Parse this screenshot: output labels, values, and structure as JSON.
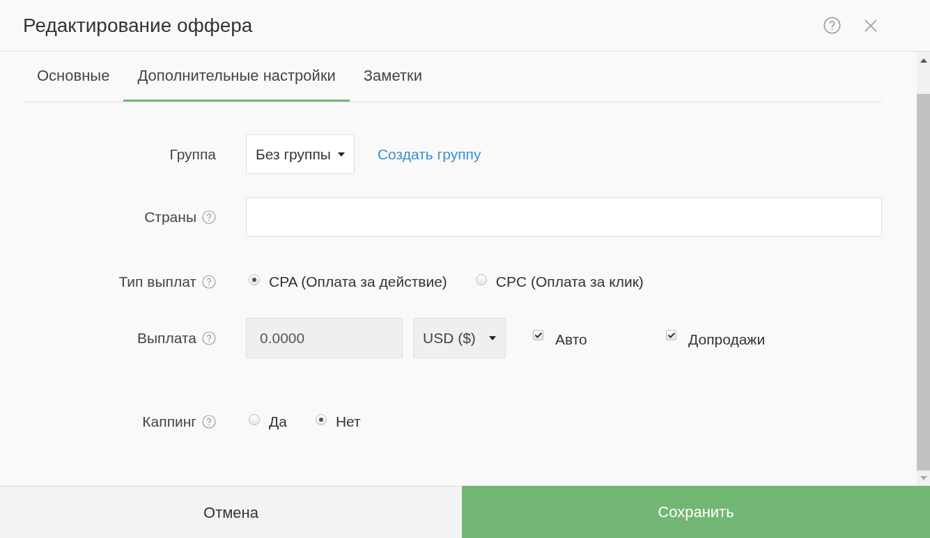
{
  "window": {
    "title": "Редактирование оффера"
  },
  "tabs": [
    {
      "label": "Основные",
      "selected": false
    },
    {
      "label": "Дополнительные настройки",
      "selected": true
    },
    {
      "label": "Заметки",
      "selected": false
    }
  ],
  "form": [
    {
      "kind": "select",
      "label": "Группа",
      "help": false,
      "value": "Без группы",
      "link": "Создать группу"
    },
    {
      "kind": "input",
      "label": "Страны",
      "help": true
    },
    {
      "kind": "radio",
      "label": "Тип выплат",
      "help": true,
      "options": [
        {
          "label": "CPA (Оплата за действие)",
          "selected": true
        },
        {
          "label": "CPC (Оплата за клик)",
          "selected": false
        }
      ]
    },
    {
      "kind": "payout",
      "label": "Выплата",
      "help": true,
      "amount": "0.0000",
      "disabled": true,
      "currency": "USD ($)",
      "checks": [
        {
          "label": "Авто",
          "checked": true
        },
        {
          "label": "Допродажи",
          "checked": true
        }
      ]
    },
    {
      "kind": "radio",
      "label": "Каппинг",
      "help": true,
      "options": [
        {
          "label": "Да",
          "selected": false
        },
        {
          "label": "Нет",
          "selected": true
        }
      ]
    }
  ],
  "buttons": {
    "cancel": "Отмена",
    "save": "Сохранить"
  }
}
